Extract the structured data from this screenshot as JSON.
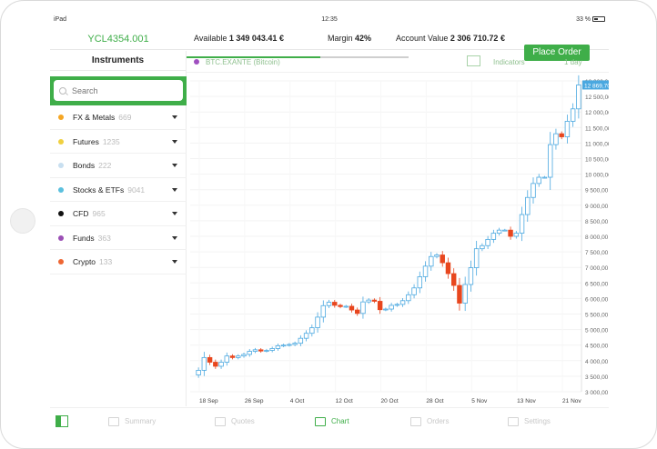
{
  "status_bar": {
    "device": "iPad",
    "time": "12:35",
    "battery": "33 %"
  },
  "account": {
    "id": "YCL4354.001",
    "available_label": "Available",
    "available_value": "1 349 043.41 €",
    "margin_label": "Margin",
    "margin_value": "42%",
    "account_value_label": "Account Value",
    "account_value": "2 306 710.72 €",
    "place_order_label": "Place Order"
  },
  "sidebar": {
    "title": "Instruments",
    "search_placeholder": "Search",
    "categories": [
      {
        "name": "FX & Metals",
        "count": "669",
        "color": "#f5a623"
      },
      {
        "name": "Futures",
        "count": "1235",
        "color": "#f0d040"
      },
      {
        "name": "Bonds",
        "count": "222",
        "color": "#c8dff0"
      },
      {
        "name": "Stocks & ETFs",
        "count": "9041",
        "color": "#5bc0de"
      },
      {
        "name": "CFD",
        "count": "965",
        "color": "#111111"
      },
      {
        "name": "Funds",
        "count": "363",
        "color": "#9b4fb5"
      },
      {
        "name": "Crypto",
        "count": "133",
        "color": "#ee6633"
      }
    ]
  },
  "chart_header": {
    "symbol": "BTC.EXANTE (Bitcoin)",
    "indicators_label": "Indicators",
    "period": "1 day"
  },
  "chart_data": {
    "type": "candlestick",
    "y_ticks": [
      "13 000,00",
      "12 500,00",
      "12 000,00",
      "11 500,00",
      "11 000,00",
      "10 500,00",
      "10 000,00",
      "9 500,00",
      "9 000,00",
      "8 500,00",
      "8 000,00",
      "7 500,00",
      "7 000,00",
      "6 500,00",
      "6 000,00",
      "5 500,00",
      "5 000,00",
      "4 500,00",
      "4 000,00",
      "3 500,00",
      "3 000,00"
    ],
    "ylim": [
      3000,
      13000
    ],
    "x_ticks": [
      "18 Sep",
      "26 Sep",
      "4 Oct",
      "12 Oct",
      "20 Oct",
      "28 Oct",
      "5 Nov",
      "13 Nov",
      "21 Nov"
    ],
    "last_price": "12 869,70",
    "up_color": "#4aa8e0",
    "down_color": "#e8461e",
    "close": [
      3690,
      4100,
      3950,
      3820,
      3950,
      4150,
      4100,
      4150,
      4200,
      4300,
      4350,
      4310,
      4330,
      4390,
      4480,
      4500,
      4520,
      4560,
      4720,
      4880,
      5060,
      5400,
      5770,
      5880,
      5780,
      5740,
      5750,
      5630,
      5520,
      5890,
      5950,
      5910,
      5640,
      5660,
      5780,
      5810,
      5930,
      6120,
      6340,
      6700,
      7040,
      7350,
      7400,
      7150,
      6800,
      6420,
      5850,
      6450,
      6990,
      7600,
      7700,
      7900,
      8100,
      8200,
      8200,
      8000,
      8100,
      8700,
      9250,
      9700,
      9900,
      9900,
      10950,
      11300,
      11200,
      11700,
      12100,
      12869.7
    ]
  },
  "tabs": [
    {
      "label": "Summary"
    },
    {
      "label": "Quotes"
    },
    {
      "label": "Chart"
    },
    {
      "label": "Orders"
    },
    {
      "label": "Settings"
    }
  ]
}
